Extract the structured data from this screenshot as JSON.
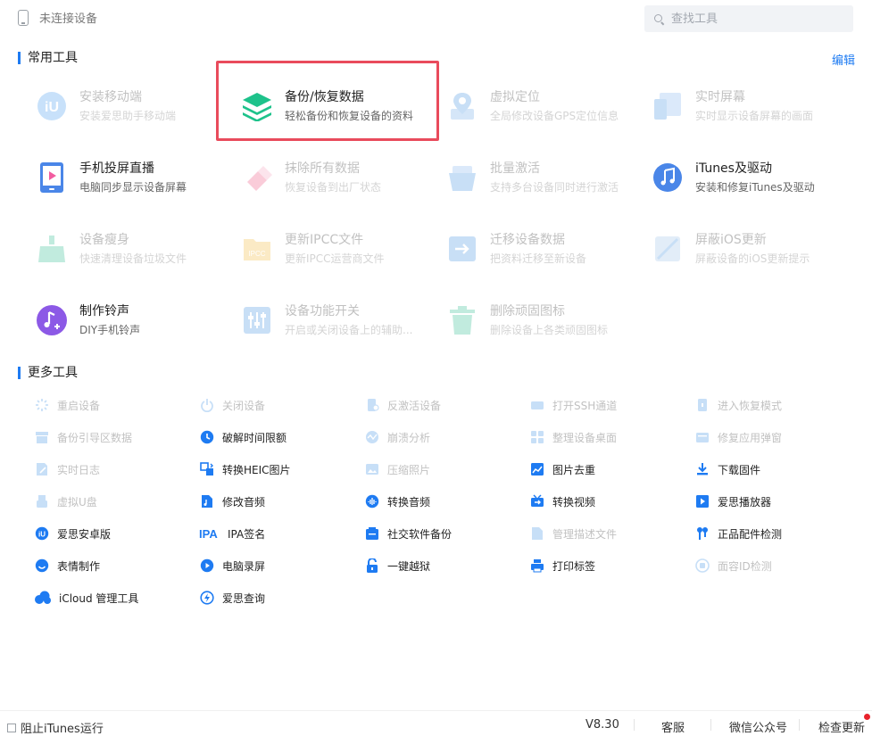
{
  "header": {
    "device_status": "未连接设备",
    "search_placeholder": "查找工具"
  },
  "common_tools": {
    "title": "常用工具",
    "edit_label": "编辑",
    "items": [
      {
        "name": "安装移动端",
        "desc": "安装爱思助手移动端",
        "icon": "aisi-app-icon",
        "enabled": false
      },
      {
        "name": "备份/恢复数据",
        "desc": "轻松备份和恢复设备的资料",
        "icon": "backup-layers-icon",
        "enabled": true,
        "highlighted": true
      },
      {
        "name": "虚拟定位",
        "desc": "全局修改设备GPS定位信息",
        "icon": "location-pin-icon",
        "enabled": false
      },
      {
        "name": "实时屏幕",
        "desc": "实时显示设备屏幕的画面",
        "icon": "live-screen-icon",
        "enabled": false
      },
      {
        "name": "手机投屏直播",
        "desc": "电脑同步显示设备屏幕",
        "icon": "screen-mirror-icon",
        "enabled": true
      },
      {
        "name": "抹除所有数据",
        "desc": "恢复设备到出厂状态",
        "icon": "eraser-icon",
        "enabled": false
      },
      {
        "name": "批量激活",
        "desc": "支持多台设备同时进行激活",
        "icon": "batch-activate-icon",
        "enabled": false
      },
      {
        "name": "iTunes及驱动",
        "desc": "安装和修复iTunes及驱动",
        "icon": "itunes-music-icon",
        "enabled": true
      },
      {
        "name": "设备瘦身",
        "desc": "快速清理设备垃圾文件",
        "icon": "broom-icon",
        "enabled": false
      },
      {
        "name": "更新IPCC文件",
        "desc": "更新IPCC运营商文件",
        "icon": "ipcc-folder-icon",
        "enabled": false
      },
      {
        "name": "迁移设备数据",
        "desc": "把资料迁移至新设备",
        "icon": "migrate-data-icon",
        "enabled": false
      },
      {
        "name": "屏蔽iOS更新",
        "desc": "屏蔽设备的iOS更新提示",
        "icon": "block-update-icon",
        "enabled": false
      },
      {
        "name": "制作铃声",
        "desc": "DIY手机铃声",
        "icon": "ringtone-icon",
        "enabled": true
      },
      {
        "name": "设备功能开关",
        "desc": "开启或关闭设备上的辅助...",
        "icon": "toggle-switches-icon",
        "enabled": false
      },
      {
        "name": "删除顽固图标",
        "desc": "删除设备上各类顽固图标",
        "icon": "trash-icon",
        "enabled": false
      }
    ]
  },
  "more_tools": {
    "title": "更多工具",
    "items": [
      {
        "label": "重启设备",
        "icon": "restart-icon",
        "enabled": false
      },
      {
        "label": "关闭设备",
        "icon": "power-icon",
        "enabled": false
      },
      {
        "label": "反激活设备",
        "icon": "deactivate-icon",
        "enabled": false
      },
      {
        "label": "打开SSH通道",
        "icon": "ssh-icon",
        "enabled": false
      },
      {
        "label": "进入恢复模式",
        "icon": "recovery-mode-icon",
        "enabled": false
      },
      {
        "label": "备份引导区数据",
        "icon": "backup-boot-icon",
        "enabled": false
      },
      {
        "label": "破解时间限额",
        "icon": "clock-icon",
        "enabled": true
      },
      {
        "label": "崩溃分析",
        "icon": "crash-analysis-icon",
        "enabled": false
      },
      {
        "label": "整理设备桌面",
        "icon": "grid-icon",
        "enabled": false
      },
      {
        "label": "修复应用弹窗",
        "icon": "fix-popup-icon",
        "enabled": false
      },
      {
        "label": "实时日志",
        "icon": "log-icon",
        "enabled": false
      },
      {
        "label": "转换HEIC图片",
        "icon": "heic-convert-icon",
        "enabled": true
      },
      {
        "label": "压缩照片",
        "icon": "compress-photo-icon",
        "enabled": false
      },
      {
        "label": "图片去重",
        "icon": "image-dedupe-icon",
        "enabled": true
      },
      {
        "label": "下载固件",
        "icon": "download-icon",
        "enabled": true
      },
      {
        "label": "虚拟U盘",
        "icon": "usb-drive-icon",
        "enabled": false
      },
      {
        "label": "修改音频",
        "icon": "audio-file-icon",
        "enabled": true
      },
      {
        "label": "转换音频",
        "icon": "audio-convert-icon",
        "enabled": true
      },
      {
        "label": "转换视频",
        "icon": "video-convert-icon",
        "enabled": true
      },
      {
        "label": "爱思播放器",
        "icon": "player-icon",
        "enabled": true
      },
      {
        "label": "爱思安卓版",
        "icon": "aisi-android-icon",
        "enabled": true
      },
      {
        "label": "IPA签名",
        "icon": "ipa-sign-icon",
        "enabled": true
      },
      {
        "label": "社交软件备份",
        "icon": "social-backup-icon",
        "enabled": true
      },
      {
        "label": "管理描述文件",
        "icon": "profile-doc-icon",
        "enabled": false
      },
      {
        "label": "正品配件检测",
        "icon": "earphone-icon",
        "enabled": true
      },
      {
        "label": "表情制作",
        "icon": "smiley-icon",
        "enabled": true
      },
      {
        "label": "电脑录屏",
        "icon": "record-icon",
        "enabled": true
      },
      {
        "label": "一键越狱",
        "icon": "unlock-icon",
        "enabled": true
      },
      {
        "label": "打印标签",
        "icon": "printer-icon",
        "enabled": true
      },
      {
        "label": "面容ID检测",
        "icon": "face-id-icon",
        "enabled": false
      },
      {
        "label": "iCloud 管理工具",
        "icon": "icloud-icon",
        "enabled": true
      },
      {
        "label": "爱思查询",
        "icon": "lightning-query-icon",
        "enabled": true
      }
    ]
  },
  "footer": {
    "block_itunes_label": "阻止iTunes运行",
    "version": "V8.30",
    "support": "客服",
    "wechat": "微信公众号",
    "check_update": "检查更新"
  },
  "colors": {
    "accent": "#1e7bf2",
    "highlight_border": "#e94b5c",
    "update_dot": "#e8222b"
  }
}
